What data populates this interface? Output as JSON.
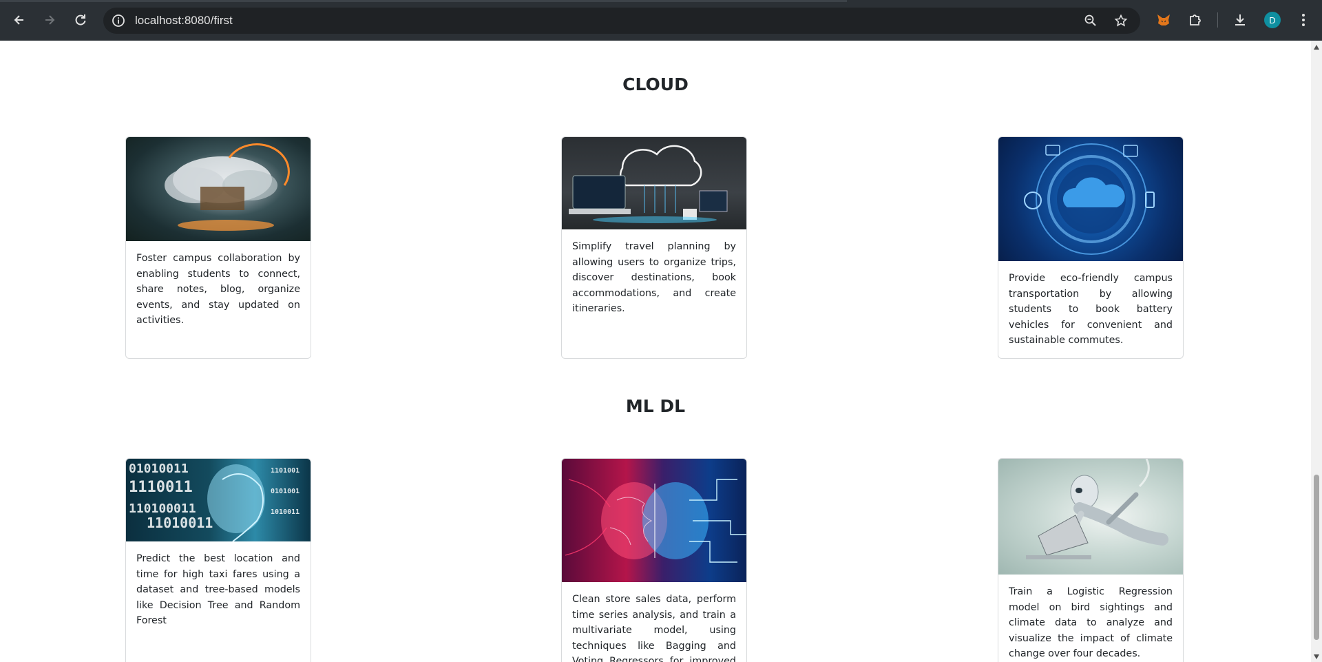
{
  "browser": {
    "url": "localhost:8080/first",
    "profile_initial": "D",
    "icons": [
      "back-icon",
      "forward-icon",
      "reload-icon",
      "site-info-icon",
      "zoom-icon",
      "bookmark-star-icon",
      "metamask-fox-icon",
      "extensions-puzzle-icon",
      "download-icon",
      "kebab-menu-icon"
    ]
  },
  "sections": [
    {
      "title": "CLOUD",
      "cards": [
        {
          "text": "Foster campus collaboration by enabling students to connect, share notes, blog, organize events, and stay updated on activities."
        },
        {
          "text": "Simplify travel planning by allowing users to organize trips, discover destinations, book accommodations, and create itineraries."
        },
        {
          "text": "Provide eco-friendly campus transportation by allowing students to book battery vehicles for convenient and sustainable commutes."
        }
      ]
    },
    {
      "title": "ML DL",
      "cards": [
        {
          "text": "Predict the best location and time for high taxi fares using a dataset and tree-based models like Decision Tree and Random Forest"
        },
        {
          "text": "Clean store sales data, perform time series analysis, and train a multivariate model, using techniques like Bagging and Voting Regressors for improved accuracy."
        },
        {
          "text": "Train a Logistic Regression model on bird sightings and climate data to analyze and visualize the impact of climate change over four decades."
        }
      ]
    }
  ]
}
